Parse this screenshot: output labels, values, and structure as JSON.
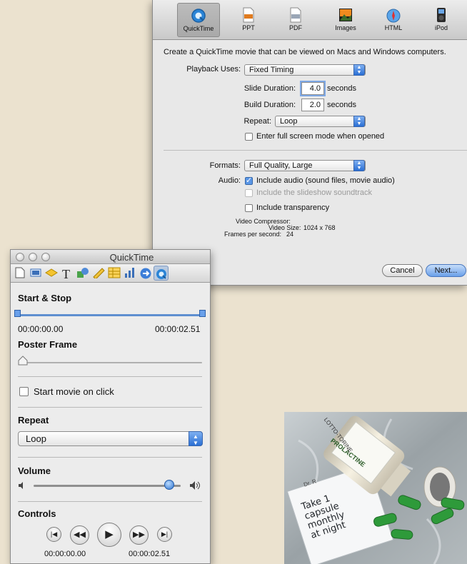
{
  "export": {
    "tabs": [
      {
        "label": "QuickTime",
        "icon": "quicktime-icon",
        "selected": true
      },
      {
        "label": "PPT",
        "icon": "ppt-file-icon",
        "selected": false
      },
      {
        "label": "PDF",
        "icon": "pdf-file-icon",
        "selected": false
      },
      {
        "label": "Images",
        "icon": "images-icon",
        "selected": false
      },
      {
        "label": "HTML",
        "icon": "safari-compass-icon",
        "selected": false
      },
      {
        "label": "iPod",
        "icon": "ipod-icon",
        "selected": false
      }
    ],
    "description": "Create a QuickTime movie that can be viewed on Macs and Windows computers.",
    "playback_label": "Playback Uses:",
    "playback_value": "Fixed Timing",
    "slide_duration_label": "Slide Duration:",
    "slide_duration_value": "4.0",
    "seconds_1": "seconds",
    "build_duration_label": "Build Duration:",
    "build_duration_value": "2.0",
    "seconds_2": "seconds",
    "repeat_label": "Repeat:",
    "repeat_value": "Loop",
    "fullscreen_label": "Enter full screen mode when opened",
    "formats_label": "Formats:",
    "formats_value": "Full Quality, Large",
    "audio_label": "Audio:",
    "include_audio_label": "Include audio (sound files, movie audio)",
    "include_soundtrack_label": "Include the slideshow soundtrack",
    "include_transparency_label": "Include transparency",
    "video_compressor_label": "Video Compressor:",
    "video_size_label": "Video Size:",
    "video_size_value": "1024 x 768",
    "fps_label": "Frames per second:",
    "fps_value": "24",
    "cancel_label": "Cancel",
    "next_label": "Next..."
  },
  "inspector": {
    "title": "QuickTime",
    "tab_icons": [
      "document-icon",
      "slide-icon",
      "transition-icon",
      "text-icon",
      "graphic-icon",
      "metrics-icon",
      "table-icon",
      "chart-icon",
      "hyperlink-icon",
      "quicktime-icon"
    ],
    "start_stop_heading": "Start & Stop",
    "start_time": "00:00:00.00",
    "end_time": "00:00:02.51",
    "poster_frame_heading": "Poster Frame",
    "start_on_click_label": "Start movie on click",
    "repeat_heading": "Repeat",
    "repeat_value": "Loop",
    "volume_heading": "Volume",
    "volume_level": 0.92,
    "controls_heading": "Controls",
    "controls_start_time": "00:00:00.00",
    "controls_end_time": "00:00:02.51"
  },
  "photo": {
    "label_brand": "PROLACTINE",
    "label_top": "LOTTO-TORINE",
    "prescription_doctor": "Dr. R",
    "prescription_text": [
      "Take 1",
      "capsule",
      "monthly",
      "at night"
    ]
  }
}
